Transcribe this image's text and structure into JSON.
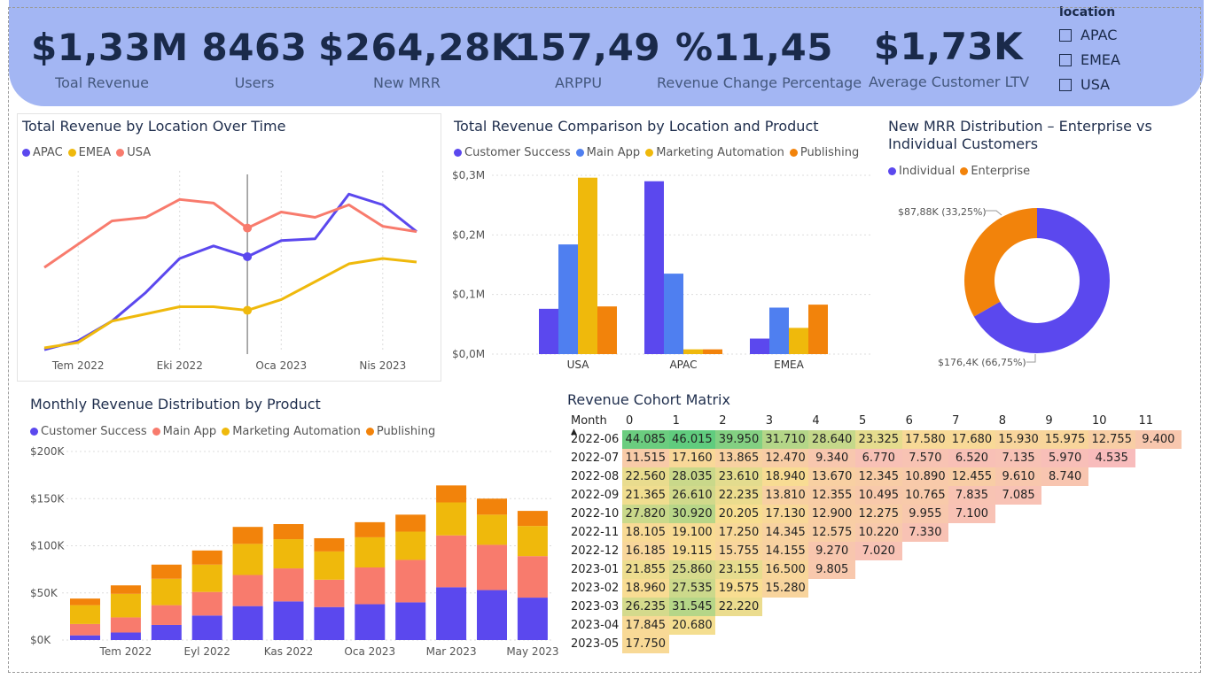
{
  "kpis": [
    {
      "value": "$1,33M",
      "label": "Toal Revenue"
    },
    {
      "value": "8463",
      "label": "Users"
    },
    {
      "value": "$264,28K",
      "label": "New MRR"
    },
    {
      "value": "157,49",
      "label": "ARPPU"
    },
    {
      "value": "%11,45",
      "label": "Revenue Change Percentage"
    },
    {
      "value": "$1,73K",
      "label": "Average Customer LTV"
    }
  ],
  "slicer": {
    "title": "location",
    "options": [
      "APAC",
      "EMEA",
      "USA"
    ]
  },
  "colors": {
    "purple": "#5b48ee",
    "blue": "#4f7ff0",
    "yellow": "#efb90c",
    "orange": "#f2830b",
    "salmon": "#f87b6d",
    "banner": "#a3b6f3"
  },
  "chart1": {
    "title": "Total Revenue by Location Over Time",
    "legend": [
      "APAC",
      "EMEA",
      "USA"
    ],
    "x_ticks": [
      "Tem 2022",
      "Eki 2022",
      "Oca 2023",
      "Nis 2023"
    ]
  },
  "chart2": {
    "title": "Total Revenue Comparison by Location and Product",
    "legend": [
      "Customer Success",
      "Main App",
      "Marketing Automation",
      "Publishing"
    ],
    "y_ticks": [
      "$0,3M",
      "$0,2M",
      "$0,1M",
      "$0,0M"
    ]
  },
  "chart3": {
    "title_line1": "New MRR Distribution – Enterprise vs",
    "title_line2": "Individual Customers",
    "legend": [
      "Individual",
      "Enterprise"
    ],
    "label_enterprise": "$87,88K (33,25%)",
    "label_individual": "$176,4K (66,75%)"
  },
  "chart4": {
    "title": "Monthly Revenue Distribution by Product",
    "legend": [
      "Customer Success",
      "Main App",
      "Marketing Automation",
      "Publishing"
    ],
    "y_ticks": [
      "$200K",
      "$150K",
      "$100K",
      "$50K",
      "$0K"
    ],
    "x_ticks": [
      "Tem 2022",
      "Eyl 2022",
      "Kas 2022",
      "Oca 2023",
      "Mar 2023",
      "May 2023"
    ]
  },
  "cohort": {
    "title": "Revenue Cohort Matrix",
    "corner": "Month",
    "columns": [
      "0",
      "1",
      "2",
      "3",
      "4",
      "5",
      "6",
      "7",
      "8",
      "9",
      "10",
      "11"
    ],
    "rows": [
      {
        "month": "2022-06",
        "values": [
          "44.085",
          "46.015",
          "39.950",
          "31.710",
          "28.640",
          "23.325",
          "17.580",
          "17.680",
          "15.930",
          "15.975",
          "12.755",
          "9.400"
        ]
      },
      {
        "month": "2022-07",
        "values": [
          "11.515",
          "17.160",
          "13.865",
          "12.470",
          "9.340",
          "6.770",
          "7.570",
          "6.520",
          "7.135",
          "5.970",
          "4.535"
        ]
      },
      {
        "month": "2022-08",
        "values": [
          "22.560",
          "28.035",
          "23.610",
          "18.940",
          "13.670",
          "12.345",
          "10.890",
          "12.455",
          "9.610",
          "8.740"
        ]
      },
      {
        "month": "2022-09",
        "values": [
          "21.365",
          "26.610",
          "22.235",
          "13.810",
          "12.355",
          "10.495",
          "10.765",
          "7.835",
          "7.085"
        ]
      },
      {
        "month": "2022-10",
        "values": [
          "27.820",
          "30.920",
          "20.205",
          "17.130",
          "12.900",
          "12.275",
          "9.955",
          "7.100"
        ]
      },
      {
        "month": "2022-11",
        "values": [
          "18.105",
          "19.100",
          "17.250",
          "14.345",
          "12.575",
          "10.220",
          "7.330"
        ]
      },
      {
        "month": "2022-12",
        "values": [
          "16.185",
          "19.115",
          "15.755",
          "14.155",
          "9.270",
          "7.020"
        ]
      },
      {
        "month": "2023-01",
        "values": [
          "21.855",
          "25.860",
          "23.155",
          "16.500",
          "9.805"
        ]
      },
      {
        "month": "2023-02",
        "values": [
          "18.960",
          "27.535",
          "19.575",
          "15.280"
        ]
      },
      {
        "month": "2023-03",
        "values": [
          "26.235",
          "31.545",
          "22.220"
        ]
      },
      {
        "month": "2023-04",
        "values": [
          "17.845",
          "20.680"
        ]
      },
      {
        "month": "2023-05",
        "values": [
          "17.750"
        ]
      }
    ]
  },
  "chart_data": [
    {
      "type": "line",
      "title": "Total Revenue by Location Over Time",
      "x": [
        "2022-06",
        "2022-07",
        "2022-08",
        "2022-09",
        "2022-10",
        "2022-11",
        "2022-12",
        "2023-01",
        "2023-02",
        "2023-03",
        "2023-04",
        "2023-05"
      ],
      "series": [
        {
          "name": "APAC",
          "values": [
            0.0,
            0.05,
            0.16,
            0.32,
            0.51,
            0.58,
            0.52,
            0.61,
            0.62,
            0.87,
            0.81,
            0.66
          ]
        },
        {
          "name": "EMEA",
          "values": [
            0.01,
            0.04,
            0.16,
            0.2,
            0.24,
            0.24,
            0.22,
            0.28,
            0.38,
            0.48,
            0.51,
            0.49
          ]
        },
        {
          "name": "USA",
          "values": [
            0.46,
            0.59,
            0.72,
            0.74,
            0.84,
            0.82,
            0.68,
            0.77,
            0.74,
            0.81,
            0.69,
            0.66
          ]
        }
      ],
      "x_ticks": [
        "Tem 2022",
        "Eki 2022",
        "Oca 2023",
        "Nis 2023"
      ]
    },
    {
      "type": "bar",
      "title": "Total Revenue Comparison by Location and Product",
      "categories": [
        "USA",
        "APAC",
        "EMEA"
      ],
      "series": [
        {
          "name": "Customer Success",
          "values": [
            0.076,
            0.29,
            0.026
          ]
        },
        {
          "name": "Main App",
          "values": [
            0.184,
            0.135,
            0.078
          ]
        },
        {
          "name": "Marketing Automation",
          "values": [
            0.296,
            0.008,
            0.044
          ]
        },
        {
          "name": "Publishing",
          "values": [
            0.08,
            0.008,
            0.083
          ]
        }
      ],
      "ylabel": "",
      "ylim": [
        0,
        0.3
      ]
    },
    {
      "type": "pie",
      "title": "New MRR Distribution – Enterprise vs Individual Customers",
      "categories": [
        "Individual",
        "Enterprise"
      ],
      "values": [
        176.4,
        87.88
      ]
    },
    {
      "type": "bar",
      "title": "Monthly Revenue Distribution by Product",
      "categories": [
        "2022-06",
        "2022-07",
        "2022-08",
        "2022-09",
        "2022-10",
        "2022-11",
        "2022-12",
        "2023-01",
        "2023-02",
        "2023-03",
        "2023-04",
        "2023-05"
      ],
      "series": [
        {
          "name": "Customer Success",
          "values": [
            5,
            8,
            16,
            26,
            36,
            41,
            35,
            38,
            40,
            56,
            53,
            45
          ]
        },
        {
          "name": "Main App",
          "values": [
            12,
            16,
            21,
            25,
            33,
            35,
            29,
            39,
            45,
            55,
            48,
            44
          ]
        },
        {
          "name": "Marketing Automation",
          "values": [
            20,
            25,
            28,
            29,
            33,
            31,
            30,
            32,
            30,
            35,
            32,
            32
          ]
        },
        {
          "name": "Publishing",
          "values": [
            7,
            9,
            15,
            15,
            18,
            16,
            14,
            16,
            18,
            18,
            17,
            16
          ]
        }
      ],
      "ylim": [
        0,
        200
      ]
    }
  ]
}
